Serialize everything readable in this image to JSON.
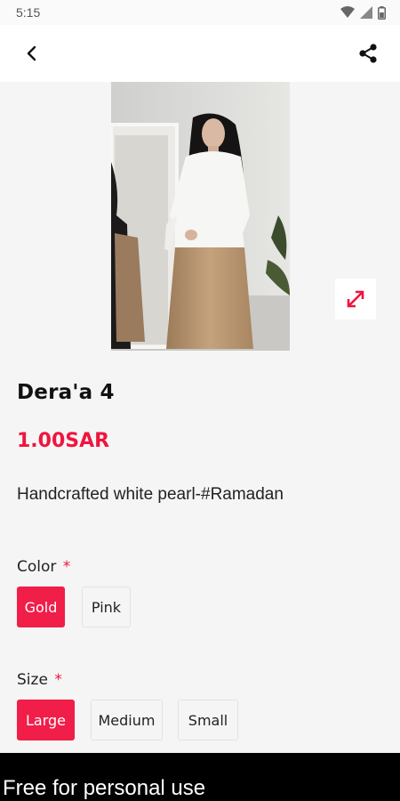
{
  "status_bar": {
    "time": "5:15"
  },
  "product": {
    "title": "Dera'a 4",
    "price": "1.00SAR",
    "description": "Handcrafted white pearl-#Ramadan"
  },
  "options": {
    "color": {
      "label": "Color",
      "required_mark": "*",
      "choices": [
        "Gold",
        "Pink"
      ],
      "selected": "Gold"
    },
    "size": {
      "label": "Size",
      "required_mark": "*",
      "choices": [
        "Large",
        "Medium",
        "Small"
      ],
      "selected": "Large"
    }
  },
  "footer": {
    "text": "Free for personal use"
  },
  "colors": {
    "accent": "#f01e48",
    "background": "#f5f5f5"
  }
}
